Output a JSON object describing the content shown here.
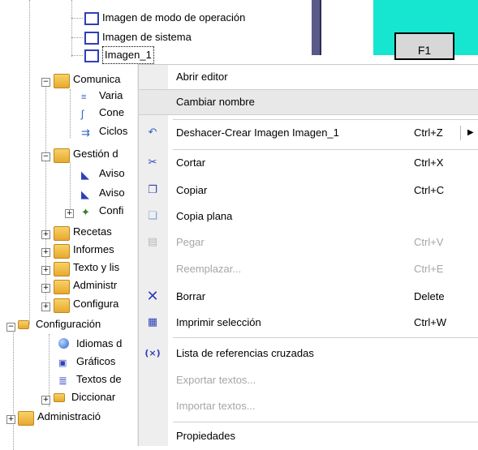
{
  "tree": {
    "nodes": [
      {
        "id": "n1",
        "label": "Imagen de modo de operación",
        "icon": "screen-icon"
      },
      {
        "id": "n2",
        "label": "Imagen de sistema",
        "icon": "screen-icon"
      },
      {
        "id": "n3",
        "label": "Imagen_1",
        "icon": "screen-icon",
        "selected": true
      },
      {
        "id": "n4",
        "label": "Comunica",
        "icon": "folder-comm-icon"
      },
      {
        "id": "n5",
        "label": "Varia",
        "icon": "variables-icon"
      },
      {
        "id": "n6",
        "label": "Cone",
        "icon": "connections-icon"
      },
      {
        "id": "n7",
        "label": "Ciclos",
        "icon": "cycles-icon"
      },
      {
        "id": "n8",
        "label": "Gestión d",
        "icon": "folder-alarm-icon"
      },
      {
        "id": "n9",
        "label": "Aviso",
        "icon": "alarm-icon"
      },
      {
        "id": "n10",
        "label": "Aviso",
        "icon": "alarm-icon"
      },
      {
        "id": "n11",
        "label": "Confi",
        "icon": "config-icon"
      },
      {
        "id": "n12",
        "label": "Recetas",
        "icon": "folder-recipes-icon"
      },
      {
        "id": "n13",
        "label": "Informes",
        "icon": "folder-reports-icon"
      },
      {
        "id": "n14",
        "label": "Texto y lis",
        "icon": "folder-text-icon"
      },
      {
        "id": "n15",
        "label": "Administr",
        "icon": "folder-admin-icon"
      },
      {
        "id": "n16",
        "label": "Configura",
        "icon": "folder-config-icon"
      },
      {
        "id": "n17",
        "label": "Configuración",
        "icon": "globe-folder-icon"
      },
      {
        "id": "n18",
        "label": "Idiomas d",
        "icon": "globe-icon"
      },
      {
        "id": "n19",
        "label": "Gráficos",
        "icon": "graphics-icon"
      },
      {
        "id": "n20",
        "label": "Textos de",
        "icon": "text-icon"
      },
      {
        "id": "n21",
        "label": "Diccionar",
        "icon": "globe-folder-icon"
      },
      {
        "id": "n22",
        "label": "Administració",
        "icon": "folder-db-icon"
      }
    ]
  },
  "screen_button": {
    "label": "F1"
  },
  "context_menu": {
    "items": [
      {
        "label": "Abrir editor",
        "shortcut": "",
        "icon": "",
        "enabled": true
      },
      {
        "label": "Cambiar nombre",
        "shortcut": "",
        "icon": "",
        "enabled": true,
        "hover": true
      },
      {
        "label": "Deshacer-Crear Imagen Imagen_1",
        "shortcut": "Ctrl+Z",
        "icon": "undo-icon",
        "enabled": true,
        "submenu": true
      },
      {
        "label": "Cortar",
        "shortcut": "Ctrl+X",
        "icon": "scissors-icon",
        "enabled": true
      },
      {
        "label": "Copiar",
        "shortcut": "Ctrl+C",
        "icon": "copy-icon",
        "enabled": true
      },
      {
        "label": "Copia plana",
        "shortcut": "",
        "icon": "flat-copy-icon",
        "enabled": true
      },
      {
        "label": "Pegar",
        "shortcut": "Ctrl+V",
        "icon": "paste-icon",
        "enabled": false
      },
      {
        "label": "Reemplazar...",
        "shortcut": "Ctrl+E",
        "icon": "",
        "enabled": false
      },
      {
        "label": "Borrar",
        "shortcut": "Delete",
        "icon": "delete-icon",
        "enabled": true
      },
      {
        "label": "Imprimir selección",
        "shortcut": "Ctrl+W",
        "icon": "print-icon",
        "enabled": true
      },
      {
        "label": "Lista de referencias cruzadas",
        "shortcut": "",
        "icon": "cross-ref-icon",
        "enabled": true
      },
      {
        "label": "Exportar textos...",
        "shortcut": "",
        "icon": "",
        "enabled": false
      },
      {
        "label": "Importar textos...",
        "shortcut": "",
        "icon": "",
        "enabled": false
      },
      {
        "label": "Propiedades",
        "shortcut": "",
        "icon": "",
        "enabled": true
      }
    ]
  },
  "colors": {
    "teal": "#16e6cf",
    "accent": "#2f3fb8",
    "disabled": "#a6a6a6"
  }
}
